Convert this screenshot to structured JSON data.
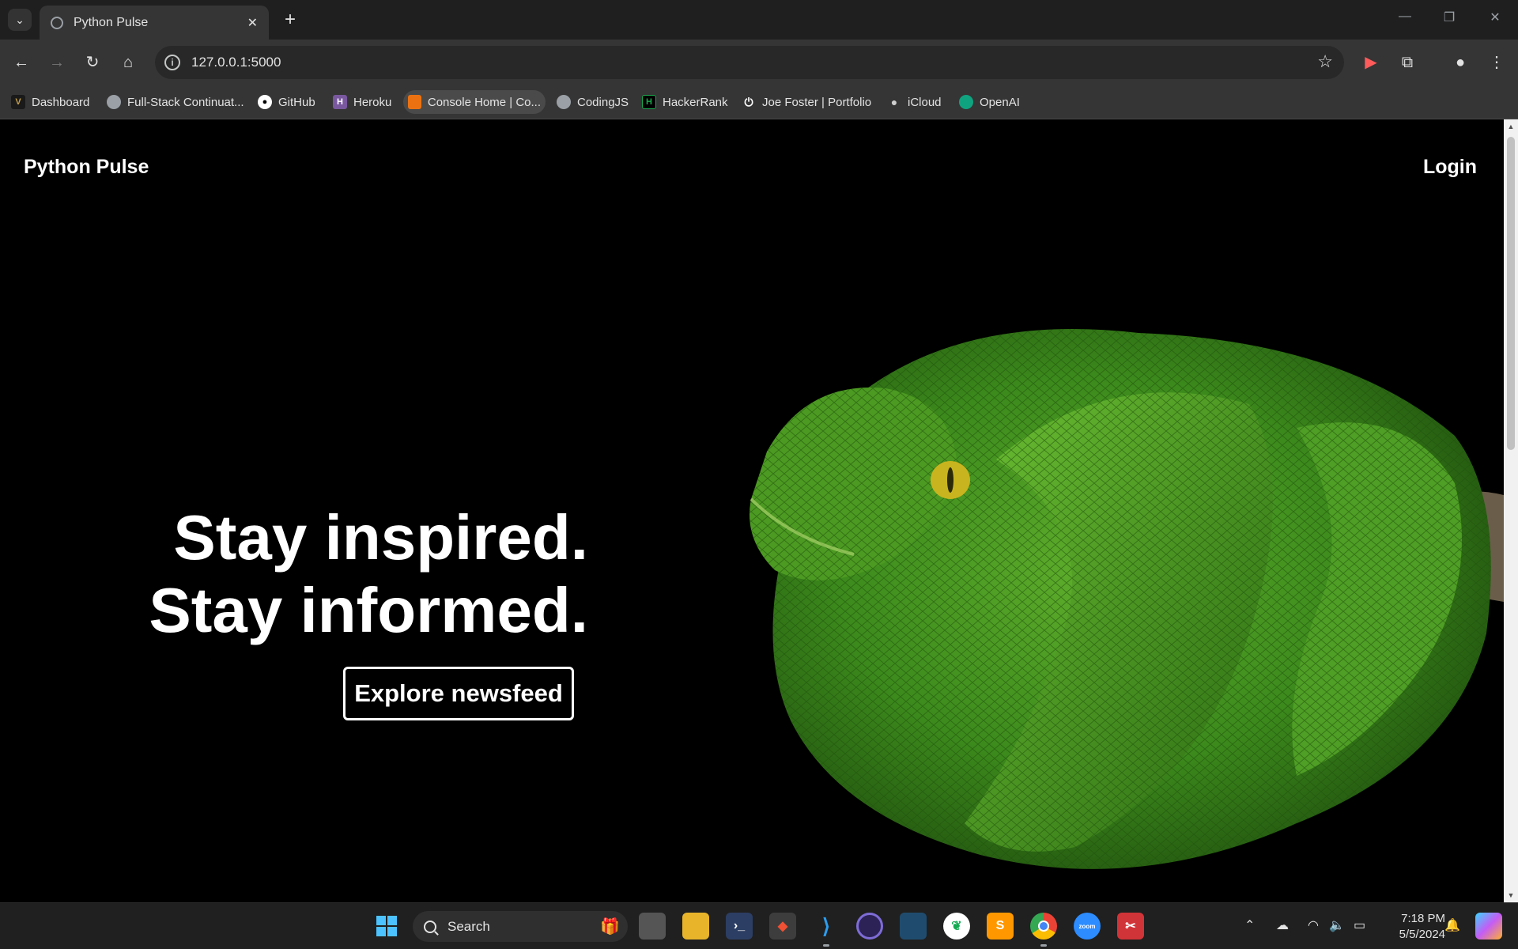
{
  "browser": {
    "tab_title": "Python Pulse",
    "url": "127.0.0.1:5000",
    "bookmarks": [
      {
        "label": "Dashboard",
        "icon": "dashboard-v-icon",
        "color": "#c6a04b"
      },
      {
        "label": "Full-Stack Continuat...",
        "icon": "globe-icon",
        "color": "#9aa0a6"
      },
      {
        "label": "GitHub",
        "icon": "github-icon",
        "color": "#ffffff"
      },
      {
        "label": "Heroku",
        "icon": "heroku-icon",
        "color": "#79589f"
      },
      {
        "label": "Console Home | Co...",
        "icon": "aws-cube-icon",
        "color": "#ec7211"
      },
      {
        "label": "CodingJS",
        "icon": "globe-icon",
        "color": "#9aa0a6"
      },
      {
        "label": "HackerRank",
        "icon": "hackerrank-icon",
        "color": "#1ba94c"
      },
      {
        "label": "Joe Foster | Portfolio",
        "icon": "power-icon",
        "color": "#ffffff"
      },
      {
        "label": "iCloud",
        "icon": "apple-icon",
        "color": "#cfcfcf"
      },
      {
        "label": "OpenAI",
        "icon": "openai-icon",
        "color": "#10a37f"
      }
    ]
  },
  "page": {
    "brand": "Python Pulse",
    "login": "Login",
    "hero_line1": "Stay inspired.",
    "hero_line2": "Stay informed.",
    "cta": "Explore newsfeed",
    "image": "green-python-snake"
  },
  "taskbar": {
    "search_placeholder": "Search",
    "time": "7:18 PM",
    "date": "5/5/2024",
    "apps": [
      "windows-start-icon",
      "task-view-icon",
      "file-explorer-icon",
      "powershell-icon",
      "git-icon",
      "vscode-icon",
      "eclipse-icon",
      "mysql-workbench-icon",
      "mongodb-icon",
      "sublime-text-icon",
      "chrome-icon",
      "zoom-icon",
      "snipping-tool-icon"
    ]
  }
}
